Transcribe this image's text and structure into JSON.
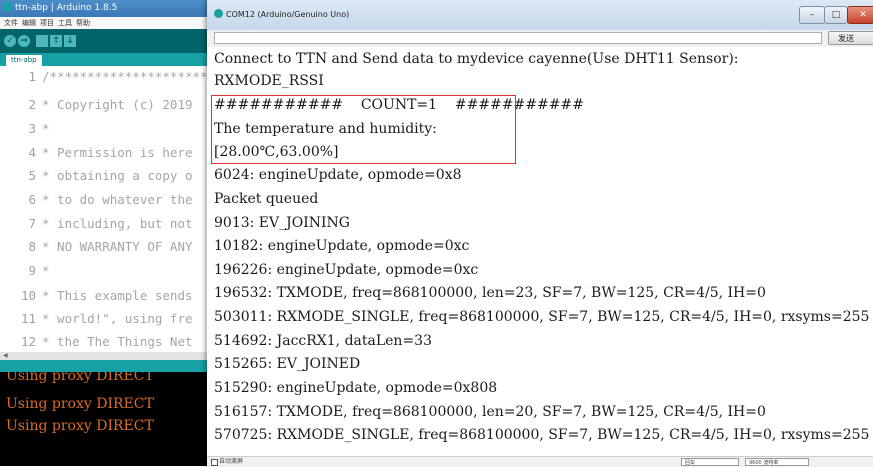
{
  "ide": {
    "title": "ttn-abp | Arduino 1.8.5",
    "menu": [
      "文件",
      "编辑",
      "项目",
      "工具",
      "帮助"
    ],
    "tab": "ttn-abp",
    "code_lines": [
      {
        "num": "1",
        "text": "/**********************"
      },
      {
        "num": "2",
        "text": "* Copyright (c) 2019"
      },
      {
        "num": "3",
        "text": "*"
      },
      {
        "num": "4",
        "text": "* Permission is here"
      },
      {
        "num": "5",
        "text": "* obtaining a copy o"
      },
      {
        "num": "6",
        "text": "* to do whatever the"
      },
      {
        "num": "7",
        "text": "* including, but not"
      },
      {
        "num": "8",
        "text": "* NO WARRANTY OF ANY"
      },
      {
        "num": "9",
        "text": "*"
      },
      {
        "num": "10",
        "text": "* This example sends"
      },
      {
        "num": "11",
        "text": "* world!\", using fre"
      },
      {
        "num": "12",
        "text": "* the The Things Net"
      }
    ],
    "console_lines": [
      "Using proxy DIRECT",
      "Using proxy DIRECT",
      "Using proxy DIRECT"
    ]
  },
  "serial_monitor": {
    "title": "COM12 (Arduino/Genuino Uno)",
    "send_label": "发送",
    "output_lines": [
      "Connect to TTN and Send data to mydevice cayenne(Use DHT11 Sensor):",
      "RXMODE_RSSI",
      "###########    COUNT=1    ###########",
      "The temperature and humidity:",
      "[28.00℃,63.00%]",
      "6024: engineUpdate, opmode=0x8",
      "Packet queued",
      "9013: EV_JOINING",
      "10182: engineUpdate, opmode=0xc",
      "196226: engineUpdate, opmode=0xc",
      "196532: TXMODE, freq=868100000, len=23, SF=7, BW=125, CR=4/5, IH=0",
      "503011: RXMODE_SINGLE, freq=868100000, SF=7, BW=125, CR=4/5, IH=0, rxsyms=255",
      "514692: JaccRX1, dataLen=33",
      "515265: EV_JOINED",
      "515290: engineUpdate, opmode=0x808",
      "516157: TXMODE, freq=868100000, len=20, SF=7, BW=125, CR=4/5, IH=0",
      "570725: RXMODE_SINGLE, freq=868100000, SF=7, BW=125, CR=4/5, IH=0, rxsyms=255"
    ],
    "autoscroll_label": "自动滚屏",
    "line_ending": "回车",
    "baud": "9600 波特率"
  },
  "colors": {
    "arduino_teal": "#006468",
    "arduino_accent": "#17a1a5",
    "console_text": "#d96b23",
    "highlight_border": "#e03030"
  }
}
